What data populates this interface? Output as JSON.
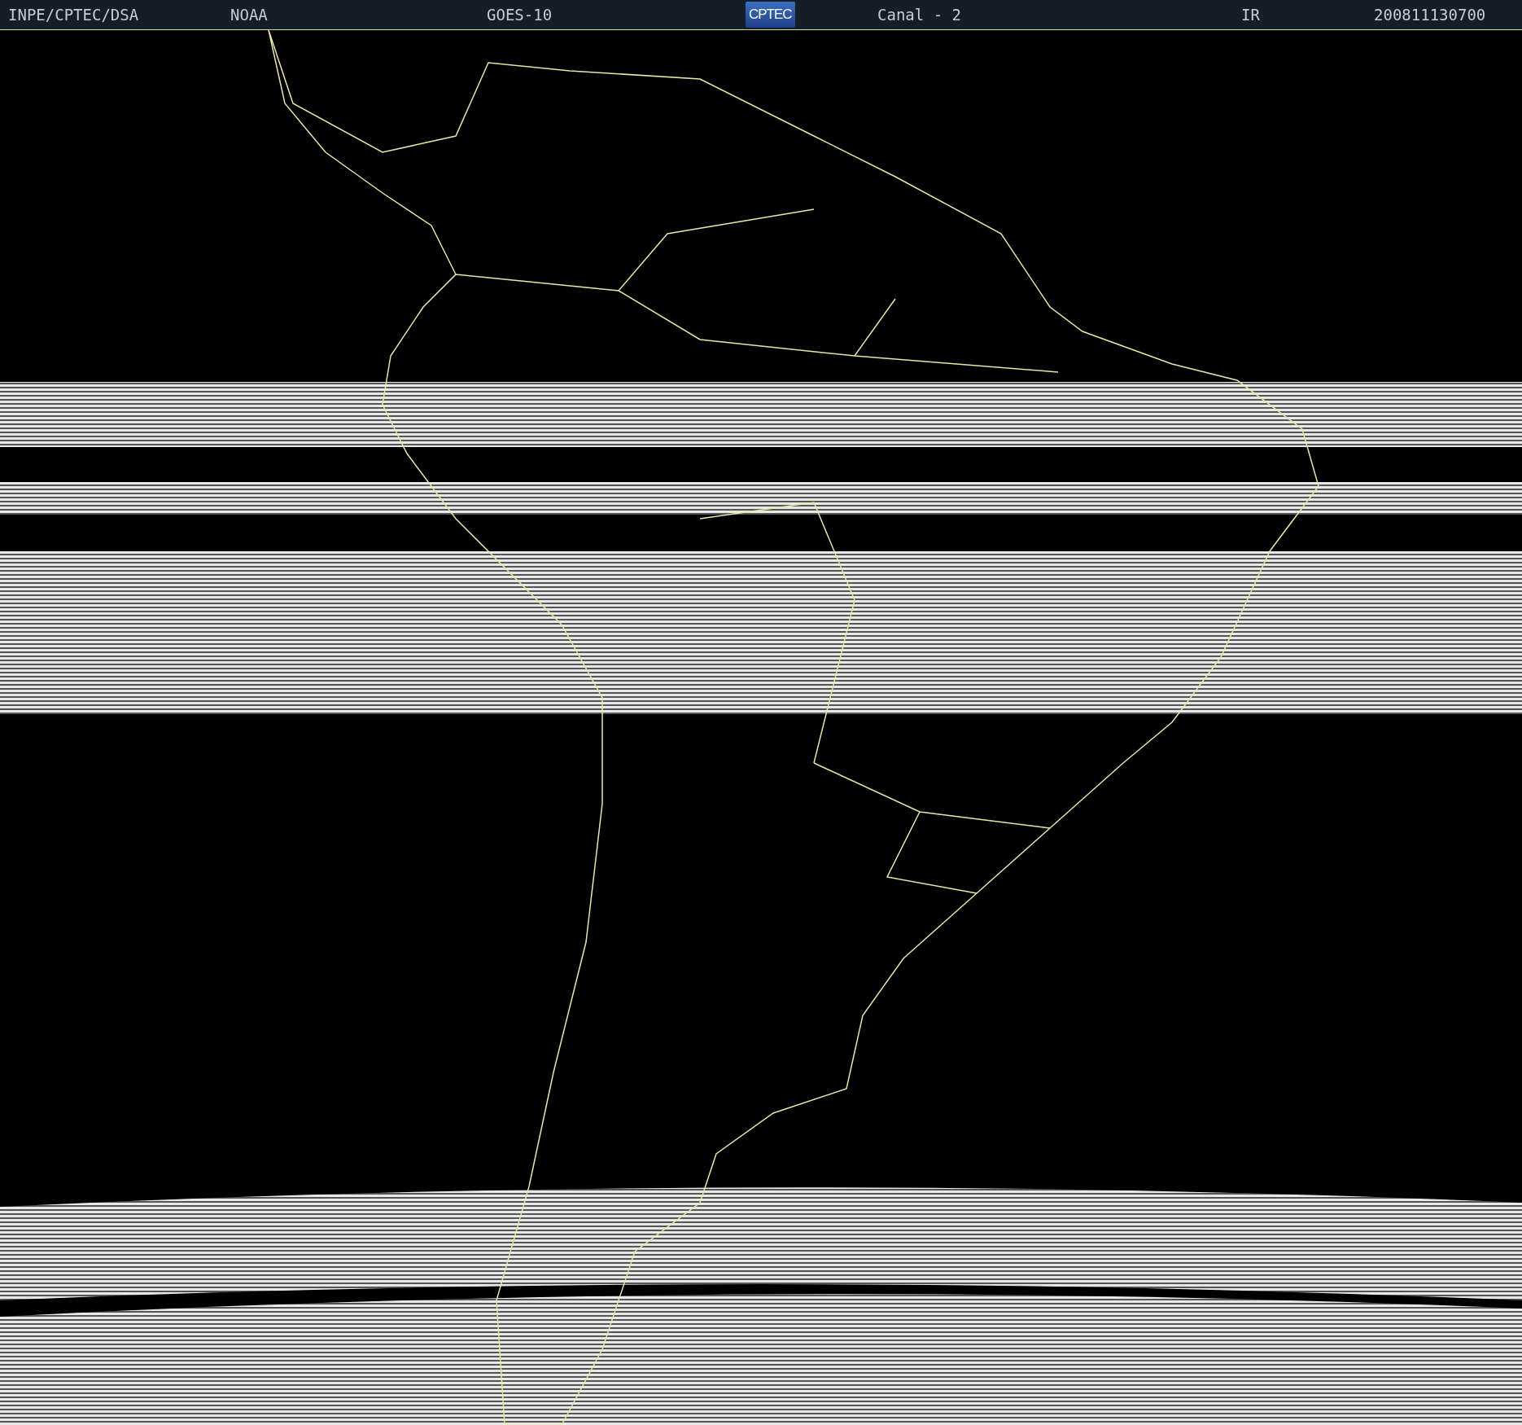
{
  "header": {
    "items": [
      {
        "kind": "text",
        "label": "INPE/CPTEC/DSA"
      },
      {
        "kind": "text",
        "label": "NOAA"
      },
      {
        "kind": "text",
        "label": "GOES-10"
      },
      {
        "kind": "logo",
        "label": "CPTEC"
      },
      {
        "kind": "text",
        "label": "Canal - 2"
      },
      {
        "kind": "text",
        "label": "IR"
      },
      {
        "kind": "text",
        "label": "200811130700"
      }
    ]
  }
}
